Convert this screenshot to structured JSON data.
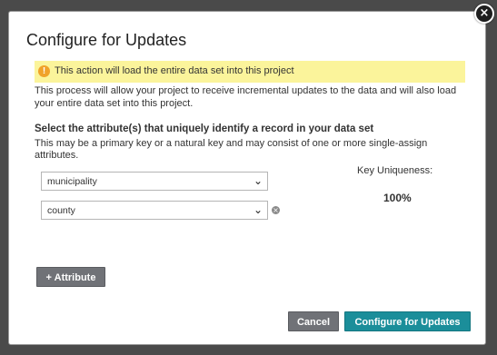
{
  "dialog": {
    "title": "Configure for Updates",
    "close_glyph": "×",
    "warning": {
      "icon": "exclamation-icon",
      "glyph": "!",
      "text": "This action will load the entire data set into this project"
    },
    "description": "This process will allow your project to receive incremental updates to the data and will also load your entire data set into this project.",
    "section": {
      "title": "Select the attribute(s) that uniquely identify a record in your data set",
      "description": "This may be a primary key or a natural key and may consist of one or more single-assign attributes."
    },
    "attributes": [
      {
        "value": "municipality"
      },
      {
        "value": "county"
      }
    ],
    "chevron_glyph": "⌄",
    "remove_glyph": "×",
    "key_uniqueness": {
      "label": "Key Uniqueness:",
      "value": "100%"
    },
    "buttons": {
      "add_attribute": "+ Attribute",
      "cancel": "Cancel",
      "configure": "Configure for Updates"
    }
  },
  "colors": {
    "primary": "#1b8e9a",
    "secondary": "#707277",
    "warning_bg": "#fbf49b",
    "warning_icon": "#f0a22a"
  }
}
